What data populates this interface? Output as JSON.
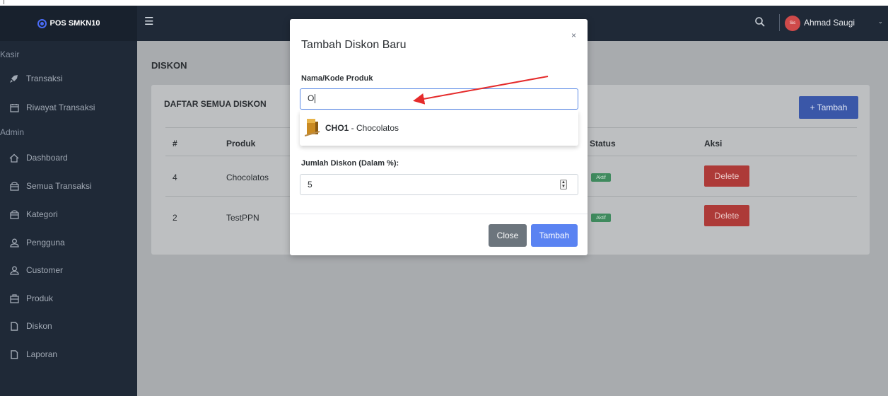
{
  "topbar": {
    "brand_name": "POS SMKN10",
    "hamburger_glyph": "☰",
    "avatar_text": "Sis",
    "username": "Ahmad Saugi",
    "chevron_glyph": "⌄"
  },
  "sidebar": {
    "section_kasir": "Kasir",
    "section_admin": "Admin",
    "items": [
      {
        "label": "Transaksi",
        "icon": "rocket-icon"
      },
      {
        "label": "Riwayat Transaksi",
        "icon": "calendar-icon"
      },
      {
        "label": "Dashboard",
        "icon": "home-icon"
      },
      {
        "label": "Semua Transaksi",
        "icon": "cart-icon"
      },
      {
        "label": "Kategori",
        "icon": "cart-icon"
      },
      {
        "label": "Pengguna",
        "icon": "user-icon"
      },
      {
        "label": "Customer",
        "icon": "user-icon"
      },
      {
        "label": "Produk",
        "icon": "box-icon"
      },
      {
        "label": "Diskon",
        "icon": "document-icon"
      },
      {
        "label": "Laporan",
        "icon": "document-icon"
      }
    ]
  },
  "main": {
    "page_title": "DISKON",
    "card_title": "DAFTAR SEMUA DISKON",
    "add_button": "+ Tambah",
    "columns": [
      "#",
      "Produk",
      "Status",
      "Aksi"
    ],
    "rows": [
      {
        "no": "4",
        "produk": "Chocolatos",
        "status": "Aktif",
        "aksi": "Delete"
      },
      {
        "no": "2",
        "produk": "TestPPN",
        "status": "Aktif",
        "aksi": "Delete"
      }
    ]
  },
  "modal": {
    "title": "Tambah Diskon Baru",
    "close_glyph": "×",
    "product_label": "Nama/Kode Produk",
    "product_value": "O",
    "suggestion": {
      "code": "CHO1",
      "separator": " - ",
      "name": "Chocolatos"
    },
    "discount_label": "Jumlah Diskon (Dalam %):",
    "discount_value": "5",
    "close_button": "Close",
    "submit_button": "Tambah"
  },
  "colors": {
    "sidebar_bg": "#1f2937",
    "primary": "#5a83f2",
    "danger": "#ad3a38",
    "success": "#3f8a5e",
    "annotation_arrow": "#e52b2b"
  }
}
